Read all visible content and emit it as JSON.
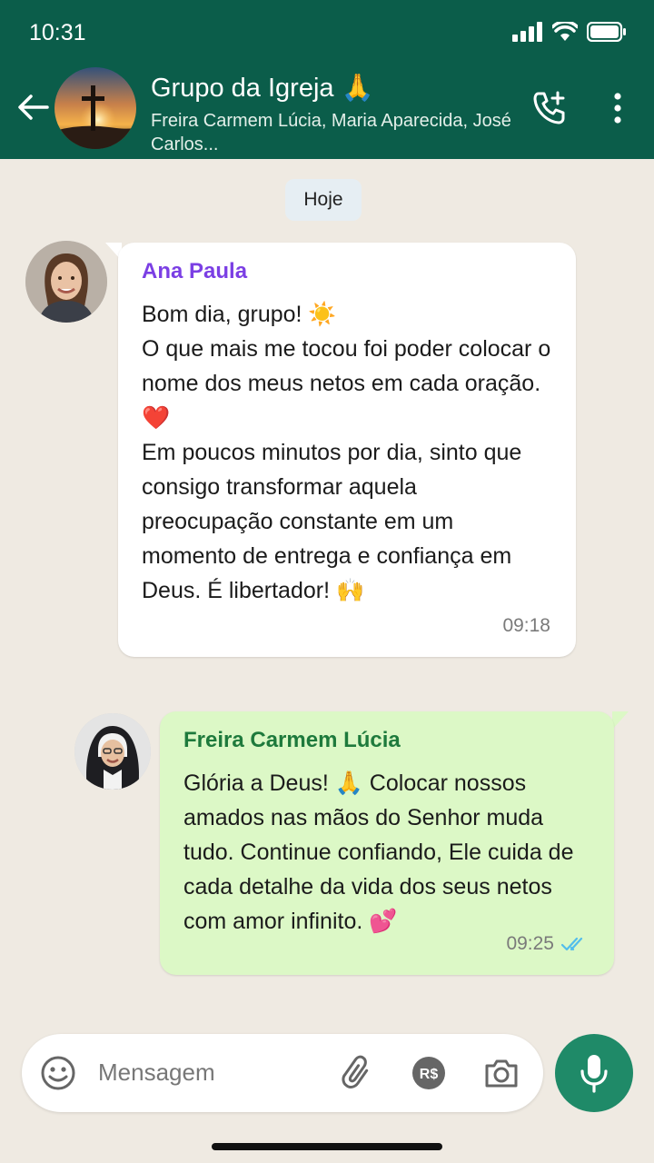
{
  "status_bar": {
    "time": "10:31"
  },
  "header": {
    "title": "Grupo da Igreja 🙏",
    "subtitle": "Freira Carmem Lúcia, Maria Aparecida, José Carlos..."
  },
  "chat": {
    "date_label": "Hoje",
    "messages": [
      {
        "sender": "Ana Paula",
        "text": "Bom dia, grupo! ☀️\nO que mais me tocou foi poder colocar o nome dos meus netos em cada oração. ❤️\nEm poucos minutos por dia, sinto que consigo transformar aquela preocupação constante em um momento de entrega e confiança em Deus. É libertador! 🙌",
        "time": "09:18",
        "sender_color": "#7b3fe4"
      },
      {
        "sender": "Freira Carmem Lúcia",
        "text": "Glória a Deus! 🙏 Colocar nossos amados nas mãos do Senhor muda tudo. Continue confiando, Ele cuida de cada detalhe da vida dos seus netos com amor infinito. 💕",
        "time": "09:25",
        "sender_color": "#1e7a3c"
      }
    ]
  },
  "composer": {
    "placeholder": "Mensagem"
  },
  "colors": {
    "header_bg": "#0b5d4a",
    "chat_bg": "#efeae2",
    "outgoing_bubble": "#dcf8c6",
    "mic_button": "#1f8a68",
    "read_ticks": "#53bdeb"
  }
}
